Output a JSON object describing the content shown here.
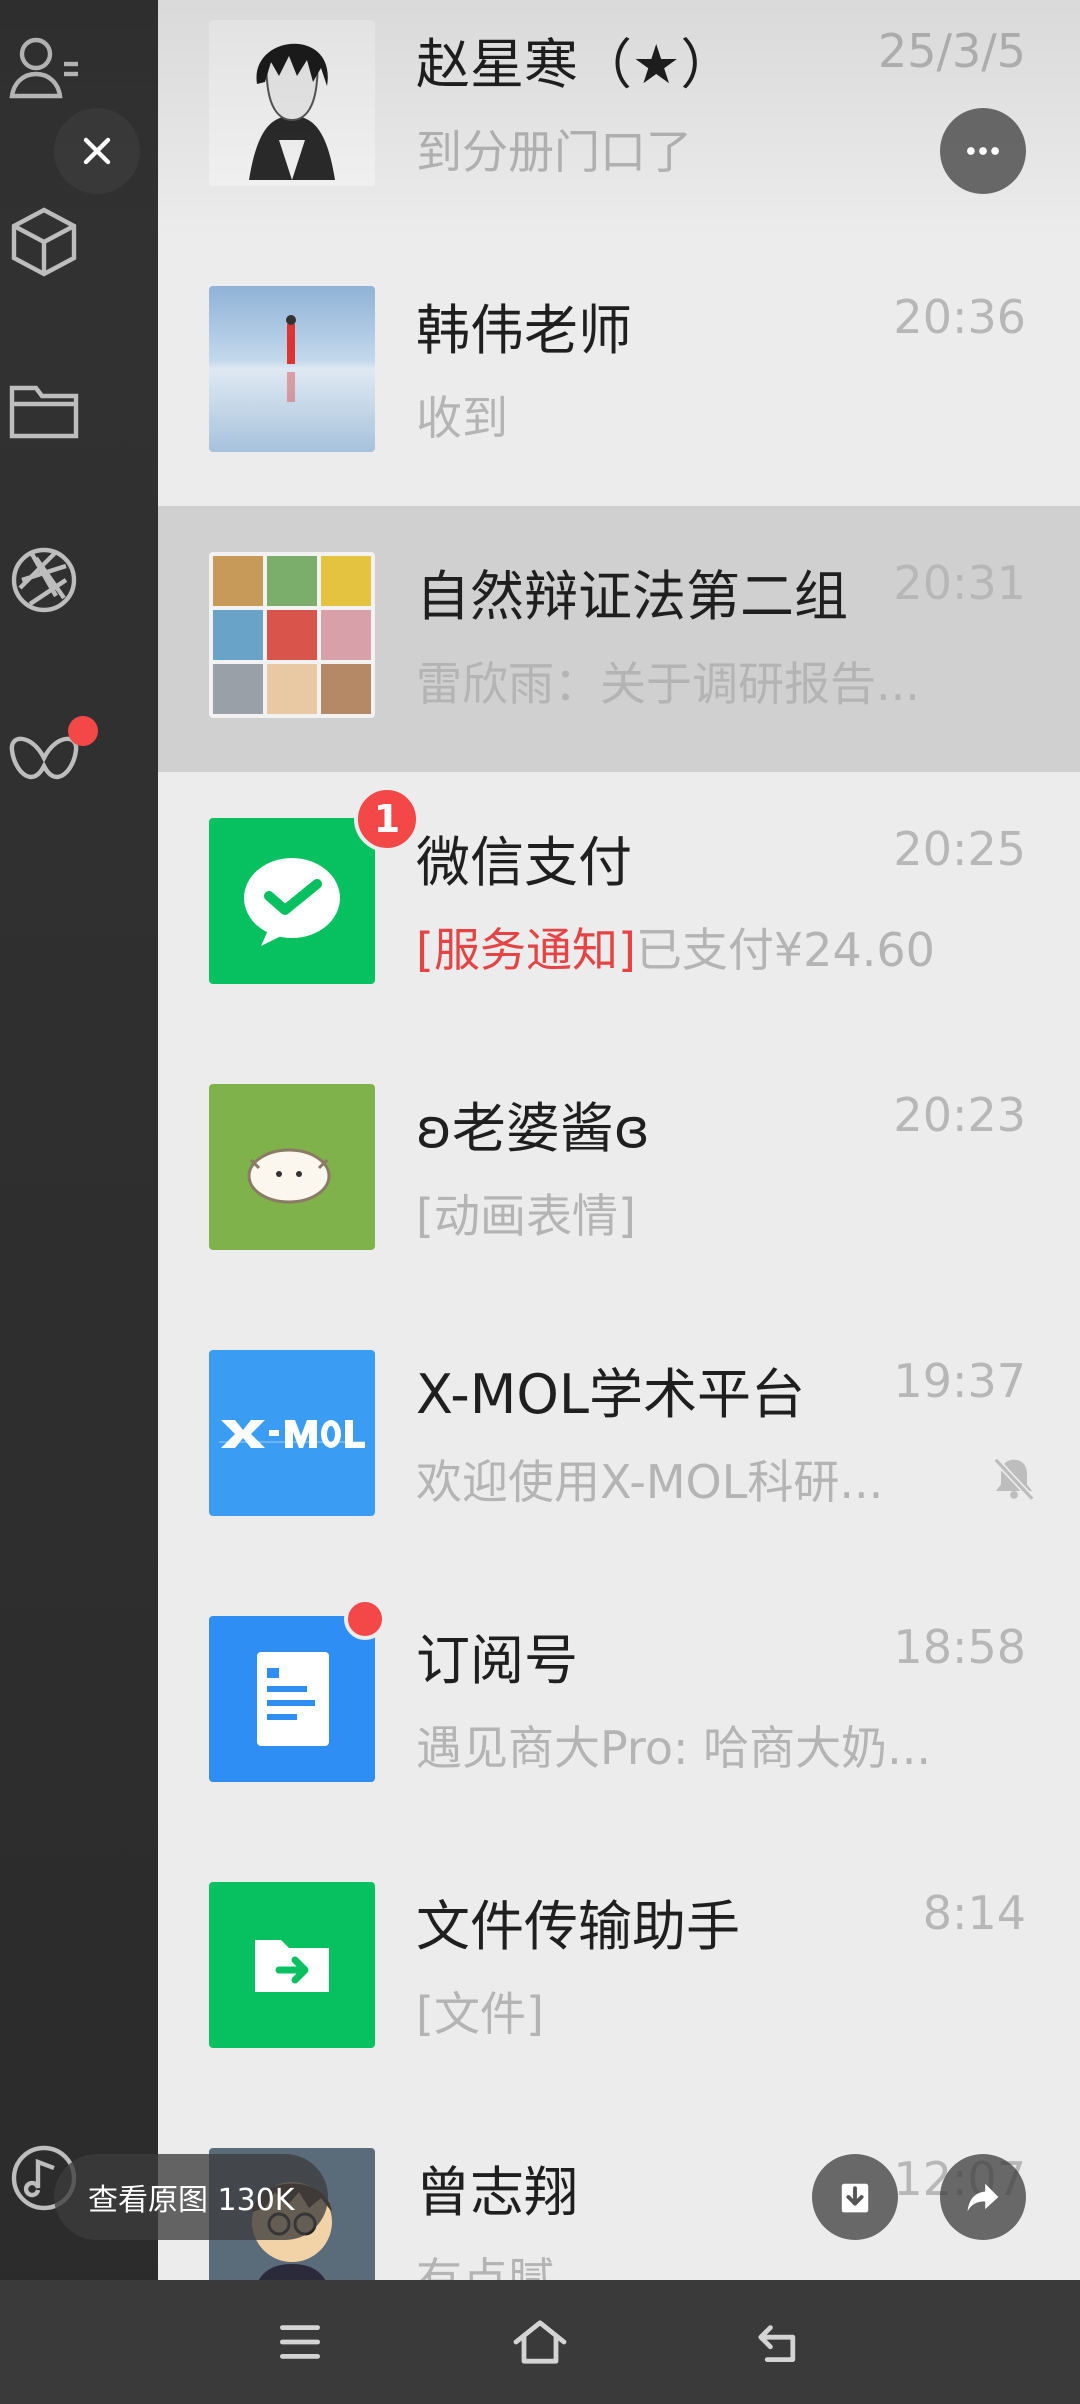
{
  "chats": [
    {
      "name": "赵星寒（★）",
      "time": "25/3/5",
      "preview": "到分册门口了"
    },
    {
      "name": "韩伟老师",
      "time": "20:36",
      "preview": "收到"
    },
    {
      "name": "自然辩证法第二组",
      "time": "20:31",
      "preview": "雷欣雨：关于调研报告..."
    },
    {
      "name": "微信支付",
      "time": "20:25",
      "preview_tag": "[服务通知]",
      "preview": "已支付¥24.60",
      "badge": "1"
    },
    {
      "name": "ʚ老婆酱ɞ",
      "time": "20:23",
      "preview": "[动画表情]"
    },
    {
      "name": "X-MOL学术平台",
      "time": "19:37",
      "preview": "欢迎使用X-MOL科研..."
    },
    {
      "name": "订阅号",
      "time": "18:58",
      "preview": "遇见商大Pro: 哈商大奶..."
    },
    {
      "name": "文件传输助手",
      "time": "8:14",
      "preview": "[文件]"
    },
    {
      "name": "曾志翔",
      "time": "12:07",
      "preview": "有点腻"
    }
  ],
  "overlay": {
    "view_original": "查看原图 130K"
  },
  "colors": {
    "accent_green": "#07c160",
    "badge_red": "#f44747",
    "tag_red": "#e64444"
  }
}
